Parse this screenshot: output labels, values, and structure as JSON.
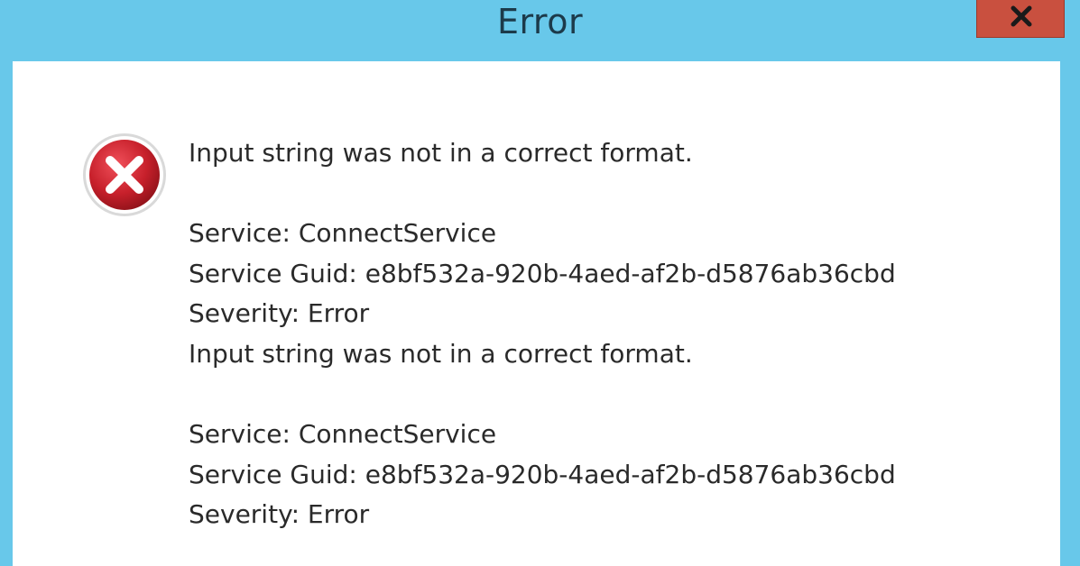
{
  "window": {
    "title": "Error",
    "close_icon": "close-x-icon"
  },
  "icons": {
    "error": "error-circle-x-icon"
  },
  "colors": {
    "title_bar": "#68c8ea",
    "close_button": "#c9503f",
    "error_icon": "#c7202b",
    "content_background": "#ffffff"
  },
  "message": {
    "headline": "Input string was not in a correct format.",
    "service_1": "Service: ConnectService",
    "guid_1": "Service Guid: e8bf532a-920b-4aed-af2b-d5876ab36cbd",
    "severity_1": "Severity: Error",
    "repeat_headline": "Input string was not in a correct format.",
    "service_2": "Service: ConnectService",
    "guid_2": "Service Guid: e8bf532a-920b-4aed-af2b-d5876ab36cbd",
    "severity_2": "Severity: Error"
  }
}
